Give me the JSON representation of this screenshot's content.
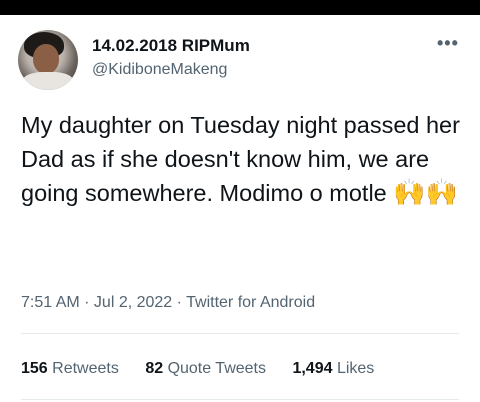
{
  "tweet": {
    "display_name": "14.02.2018 RIPMum",
    "handle": "@KidiboneMakeng",
    "more_glyph": "•••",
    "text": "My daughter on Tuesday night passed her Dad as if she doesn't know him, we are going somewhere. Modimo o motle",
    "emoji": "🙌🙌",
    "time": "7:51 AM",
    "date": "Jul 2, 2022",
    "source": "Twitter for Android",
    "separator": " · ",
    "stats": {
      "retweets_count": "156",
      "retweets_label": "Retweets",
      "quote_count": "82",
      "quote_label": "Quote Tweets",
      "likes_count": "1,494",
      "likes_label": "Likes"
    }
  },
  "icons": {
    "avatar": "profile-photo",
    "more": "more-options-icon",
    "emoji": "raising-hands-emoji"
  }
}
